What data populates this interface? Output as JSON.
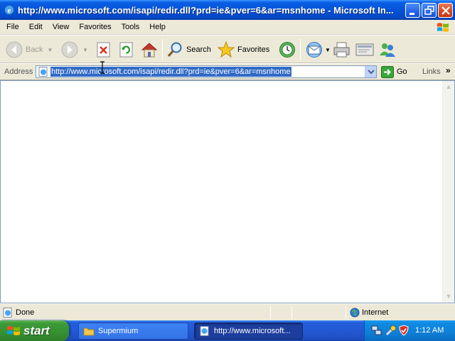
{
  "window": {
    "title": "http://www.microsoft.com/isapi/redir.dll?prd=ie&pver=6&ar=msnhome - Microsoft In..."
  },
  "menu": {
    "items": [
      "File",
      "Edit",
      "View",
      "Favorites",
      "Tools",
      "Help"
    ]
  },
  "toolbar": {
    "back_label": "Back",
    "search_label": "Search",
    "favorites_label": "Favorites"
  },
  "address": {
    "label": "Address",
    "url": "http://www.microsoft.com/isapi/redir.dll?prd=ie&pver=6&ar=msnhome",
    "go_label": "Go",
    "links_label": "Links"
  },
  "status": {
    "text": "Done",
    "zone": "Internet"
  },
  "taskbar": {
    "start_label": "start",
    "tasks": [
      {
        "label": "Supermium"
      },
      {
        "label": "http://www.microsoft..."
      }
    ],
    "clock": "1:12 AM"
  },
  "colors": {
    "titlebar": "#0553d8",
    "chrome": "#ece9d8",
    "selection": "#316ac5",
    "start": "#379232",
    "taskbar": "#2358d3",
    "tray": "#0e7fd6"
  }
}
